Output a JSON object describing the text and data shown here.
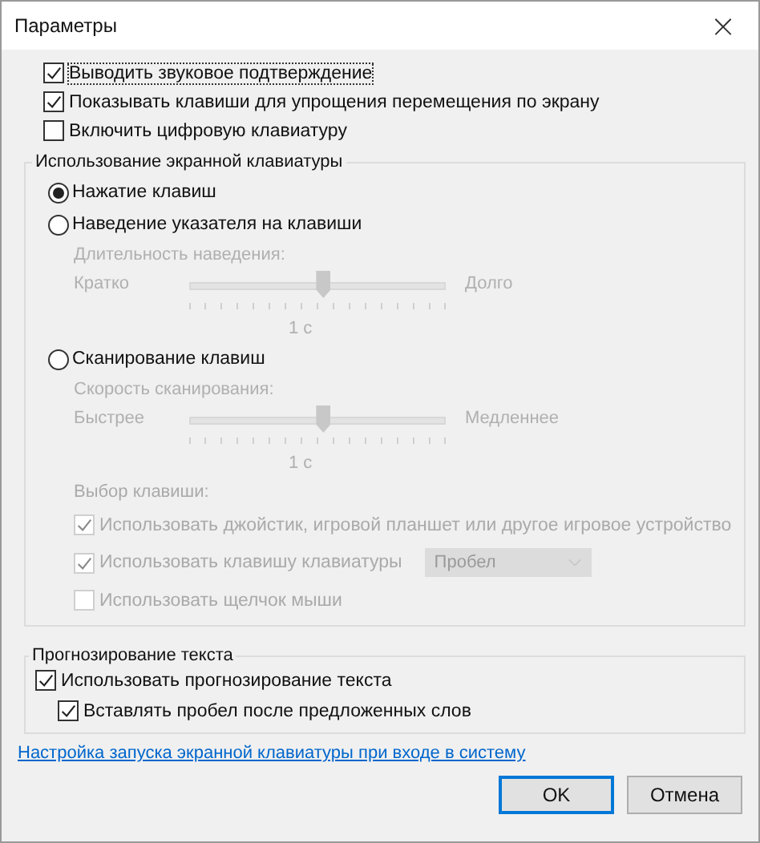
{
  "window": {
    "title": "Параметры",
    "close": "×"
  },
  "options": [
    {
      "label": "Выводить звуковое подтверждение",
      "checked": true,
      "focused": true
    },
    {
      "label": "Показывать клавиши для упрощения перемещения по экрану",
      "checked": true,
      "focused": false
    },
    {
      "label": "Включить цифровую клавиатуру",
      "checked": false,
      "focused": false
    }
  ],
  "keyboard_group": {
    "title": "Использование экранной клавиатуры",
    "items": [
      {
        "kind": "radio",
        "label": "Нажатие клавиш",
        "selected": true
      },
      {
        "kind": "radio",
        "label": "Наведение указателя на клавиши",
        "selected": false
      },
      {
        "kind": "slider",
        "caption": "Длительность наведения:",
        "min_label": "Кратко",
        "max_label": "Долго",
        "reading": "1 с",
        "level": 0.52,
        "disabled": true
      },
      {
        "kind": "radio",
        "label": "Сканирование клавиш",
        "selected": false
      },
      {
        "kind": "slider",
        "caption": "Скорость сканирования:",
        "min_label": "Быстрее",
        "max_label": "Медленнее",
        "reading": "1 с",
        "level": 0.52,
        "disabled": true
      },
      {
        "kind": "heading",
        "label": "Выбор клавиши:",
        "disabled": true
      },
      {
        "kind": "checkbox",
        "label": "Использовать джойстик, игровой планшет или другое игровое устройство",
        "checked": true,
        "disabled": true
      },
      {
        "kind": "checkbox",
        "label": "Использовать клавишу клавиатуры",
        "checked": true,
        "disabled": true,
        "dropdown": {
          "value": "Пробел"
        }
      },
      {
        "kind": "checkbox",
        "label": "Использовать щелчок мыши",
        "checked": false,
        "disabled": true
      }
    ]
  },
  "prediction_group": {
    "title": "Прогнозирование текста",
    "items": [
      {
        "label": "Использовать прогнозирование текста",
        "checked": true,
        "children": [
          {
            "label": "Вставлять пробел после предложенных слов",
            "checked": true
          }
        ]
      }
    ]
  },
  "link": "Настройка запуска экранной клавиатуры при входе в систему",
  "buttons": [
    {
      "label": "OK",
      "default": true
    },
    {
      "label": "Отмена",
      "default": false
    }
  ]
}
